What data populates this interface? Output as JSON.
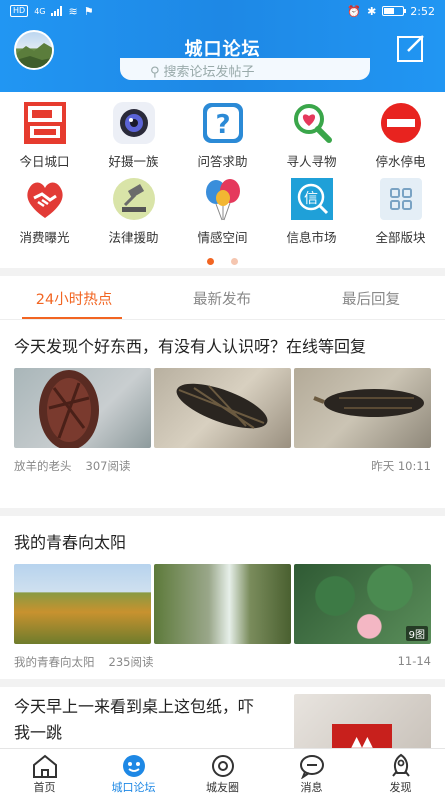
{
  "status_bar": {
    "left": "HD",
    "network": "4G",
    "time": "2:52"
  },
  "header": {
    "title": "城口论坛",
    "search_placeholder": "搜索论坛发帖子"
  },
  "colors": {
    "brand": "#1e88e5",
    "accent": "#f26522",
    "dot_active": "#f26522",
    "dot_inactive": "#f5c6b0"
  },
  "grid": [
    {
      "label": "今日城口",
      "icon": "news-icon"
    },
    {
      "label": "好摄一族",
      "icon": "camera-icon"
    },
    {
      "label": "问答求助",
      "icon": "question-icon"
    },
    {
      "label": "寻人寻物",
      "icon": "search-heart-icon"
    },
    {
      "label": "停水停电",
      "icon": "stop-icon"
    },
    {
      "label": "消费曝光",
      "icon": "handshake-icon"
    },
    {
      "label": "法律援助",
      "icon": "gavel-icon"
    },
    {
      "label": "情感空间",
      "icon": "balloons-icon"
    },
    {
      "label": "信息市场",
      "icon": "info-icon"
    },
    {
      "label": "全部版块",
      "icon": "grid-icon"
    }
  ],
  "tabs": [
    "24小时热点",
    "最新发布",
    "最后回复"
  ],
  "posts": [
    {
      "title": "今天发现个好东西，有没有人认识呀？在线等回复",
      "author": "放羊的老头",
      "reads": "307阅读",
      "time": "昨天 10:11"
    },
    {
      "title": "我的青春向太阳",
      "author": "我的青春向太阳",
      "reads": "235阅读",
      "time": "11-14",
      "badge": "9图"
    },
    {
      "title": "今天早上一来看到桌上这包纸，吓我一跳"
    }
  ],
  "nav": [
    "首页",
    "城口论坛",
    "城友圈",
    "消息",
    "发现"
  ]
}
